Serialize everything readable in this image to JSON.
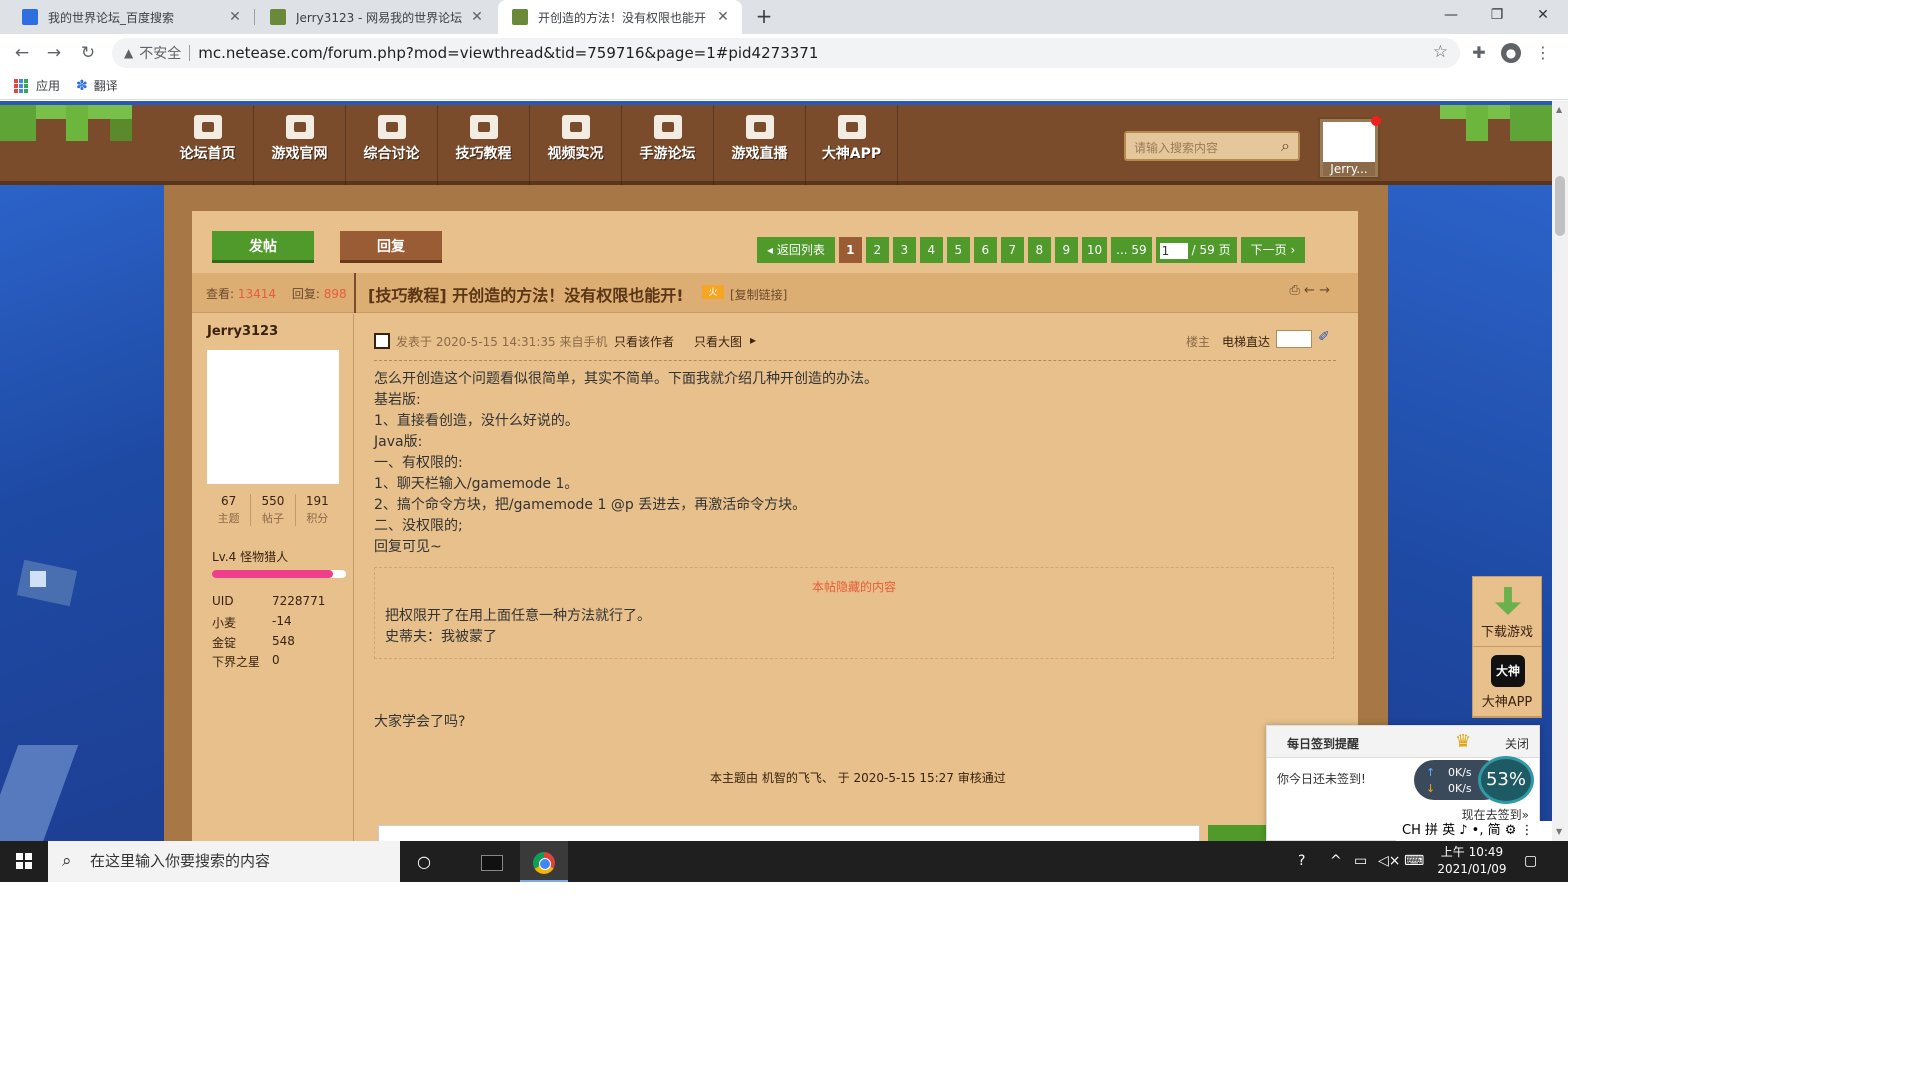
{
  "browser": {
    "tabs": [
      {
        "title": "我的世界论坛_百度搜索"
      },
      {
        "title": "Jerry3123 - 网易我的世界论坛"
      },
      {
        "title": "开创造的方法！没有权限也能开"
      }
    ],
    "insecure_label": "不安全",
    "url": "mc.netease.com/forum.php?mod=viewthread&tid=759716&page=1#pid4273371",
    "bookmarks": [
      {
        "label": "应用"
      },
      {
        "label": "翻译"
      }
    ]
  },
  "site_nav": {
    "items": [
      {
        "label": "论坛首页"
      },
      {
        "label": "游戏官网"
      },
      {
        "label": "综合讨论"
      },
      {
        "label": "技巧教程"
      },
      {
        "label": "视频实况"
      },
      {
        "label": "手游论坛"
      },
      {
        "label": "游戏直播"
      },
      {
        "label": "大神APP"
      }
    ],
    "search_placeholder": "请输入搜索内容",
    "user_name": "Jerry..."
  },
  "actions": {
    "post": "发帖",
    "reply": "回复"
  },
  "pager": {
    "back": "返回列表",
    "pages": [
      "1",
      "2",
      "3",
      "4",
      "5",
      "6",
      "7",
      "8",
      "9",
      "10",
      "... 59"
    ],
    "current_input": "1",
    "total": "/ 59 页",
    "next": "下一页"
  },
  "thread": {
    "views_label": "查看:",
    "views": "13414",
    "replies_label": "回复:",
    "replies": "898",
    "title": "[技巧教程] 开创造的方法！没有权限也能开!",
    "hot_badge": "火",
    "copy_link": "[复制链接]"
  },
  "author": {
    "name": "Jerry3123",
    "counts": [
      {
        "value": "67",
        "label": "主题"
      },
      {
        "value": "550",
        "label": "帖子"
      },
      {
        "value": "191",
        "label": "积分"
      }
    ],
    "level": "Lv.4 怪物猎人",
    "level_progress": 0.9,
    "fields": [
      {
        "key": "UID",
        "value": "7228771"
      },
      {
        "key": "小麦",
        "value": "-14"
      },
      {
        "key": "金锭",
        "value": "548"
      },
      {
        "key": "下界之星",
        "value": "0"
      }
    ]
  },
  "post": {
    "posted": "发表于 2020-5-15 14:31:35 来自手机",
    "only_author": "只看该作者",
    "only_image": "只看大图",
    "floor": "楼主",
    "lift": "电梯直达",
    "lines": [
      "怎么开创造这个问题看似很简单，其实不简单。下面我就介绍几种开创造的办法。",
      "基岩版:",
      "1、直接看创造，没什么好说的。",
      "Java版:",
      "一、有权限的:",
      "1、聊天栏输入/gamemode 1。",
      "2、搞个命令方块，把/gamemode 1 @p 丢进去，再激活命令方块。",
      "二、没权限的;",
      "回复可见~"
    ],
    "hidden_title": "本帖隐藏的内容",
    "hidden_lines": [
      "把权限开了在用上面任意一种方法就行了。",
      "史蒂夫：我被蒙了"
    ],
    "closing": "大家学会了吗?",
    "audit": "本主题由 机智的飞飞、 于 2020-5-15 15:27 审核通过"
  },
  "float_panel": {
    "download": "下载游戏",
    "dashen_icon": "大神",
    "dashen": "大神APP"
  },
  "signin": {
    "title": "每日签到提醒",
    "close": "关闭",
    "message": "你今日还未签到!",
    "action": "现在去签到»"
  },
  "net_widget": {
    "up": "0K/s",
    "down": "0K/s",
    "percent": "53%"
  },
  "ime_bar": "CH 拼 英 ♪ •, 简 ⚙ ⋮",
  "taskbar": {
    "search_placeholder": "在这里输入你要搜索的内容",
    "time": "上午 10:49",
    "date": "2021/01/09"
  },
  "colors": {
    "nav_brown": "#7a4c2c",
    "content_tan": "#e7c08b",
    "green_button": "#4f9a2a",
    "background_blue": "#2a58b8"
  }
}
